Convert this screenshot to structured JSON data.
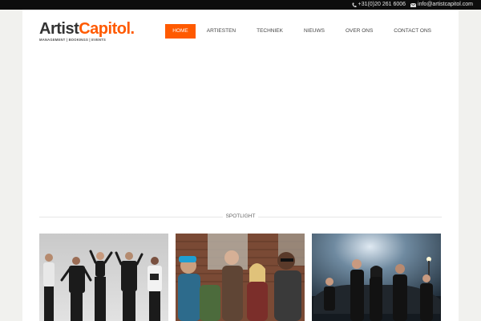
{
  "topbar": {
    "phone": "+31(0)20 261 6006",
    "phone_icon": "phone-icon",
    "email": "info@artistcapitol.com",
    "email_icon": "envelope-icon"
  },
  "logo": {
    "word1": "Artist",
    "word2": "Capitol",
    "dot": ".",
    "tagline": "MANAGEMENT | BOOKINGS | EVENTS"
  },
  "nav": {
    "items": [
      {
        "label": "HOME",
        "active": true
      },
      {
        "label": "ARTIESTEN"
      },
      {
        "label": "TECHNIEK"
      },
      {
        "label": "NIEUWS"
      },
      {
        "label": "OVER ONS"
      },
      {
        "label": "CONTACT ONS"
      }
    ]
  },
  "spotlight": {
    "title": "SPOTLIGHT"
  },
  "colors": {
    "accent": "#ff5a00",
    "topbar_bg": "#0d0d0d",
    "page_bg": "#f1f1ee"
  }
}
